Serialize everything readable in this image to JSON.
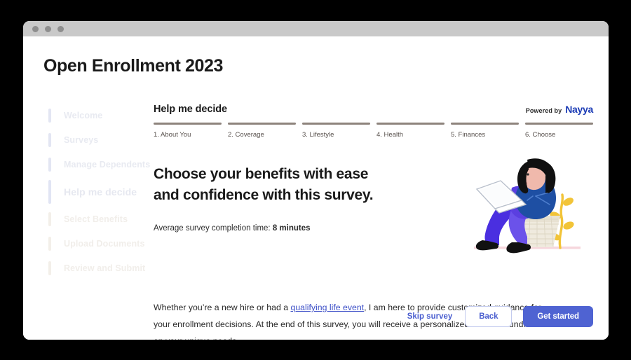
{
  "window": {
    "traffic_lights": [
      "close",
      "minimize",
      "maximize"
    ]
  },
  "page_title": "Open Enrollment 2023",
  "sidebar": {
    "items": [
      {
        "label": "Welcome",
        "state": "done"
      },
      {
        "label": "Surveys",
        "state": "done"
      },
      {
        "label": "Manage Dependents",
        "state": "done"
      },
      {
        "label": "Help me decide",
        "state": "active"
      },
      {
        "label": "Select Benefits",
        "state": "upcoming"
      },
      {
        "label": "Upload Documents",
        "state": "upcoming"
      },
      {
        "label": "Review and Submit",
        "state": "upcoming"
      }
    ]
  },
  "main": {
    "section_title": "Help me decide",
    "powered_by_label": "Powered by",
    "brand": "Nayya",
    "steps": [
      {
        "label": "1. About You"
      },
      {
        "label": "2. Coverage"
      },
      {
        "label": "3. Lifestyle"
      },
      {
        "label": "4. Health"
      },
      {
        "label": "5. Finances"
      },
      {
        "label": "6. Choose"
      }
    ],
    "heading_line1": "Choose your benefits with ease",
    "heading_line2": "and confidence with this survey.",
    "avg_time_prefix": "Average survey completion time:",
    "avg_time_value": "8 minutes",
    "body_part1": "Whether you’re a new hire or had a ",
    "body_link": "qualifying life event",
    "body_part2": ", I am here to provide customized guidance for your enrollment decisions. At the end of this survey, you will receive a personalized benefits bundle based on your unique needs."
  },
  "footer": {
    "skip_label": "Skip survey",
    "back_label": "Back",
    "primary_label": "Get started"
  },
  "illustration": {
    "name": "woman-with-laptop-on-stool",
    "colors": {
      "hair": "#111111",
      "skin": "#f0b9ac",
      "top": "#1e4fa3",
      "pants": "#5b3fe0",
      "shoes": "#111111",
      "stool": "#efeade",
      "plant": "#f2c438",
      "ground": "#f6d6dc",
      "laptop": "#ffffff"
    }
  },
  "colors": {
    "brand_blue": "#1b3bb5",
    "accent": "#4f63d2",
    "link": "#3b4ec7",
    "step_bar": "#8d837c",
    "titlebar": "#c9c9c9",
    "background": "#000000"
  }
}
